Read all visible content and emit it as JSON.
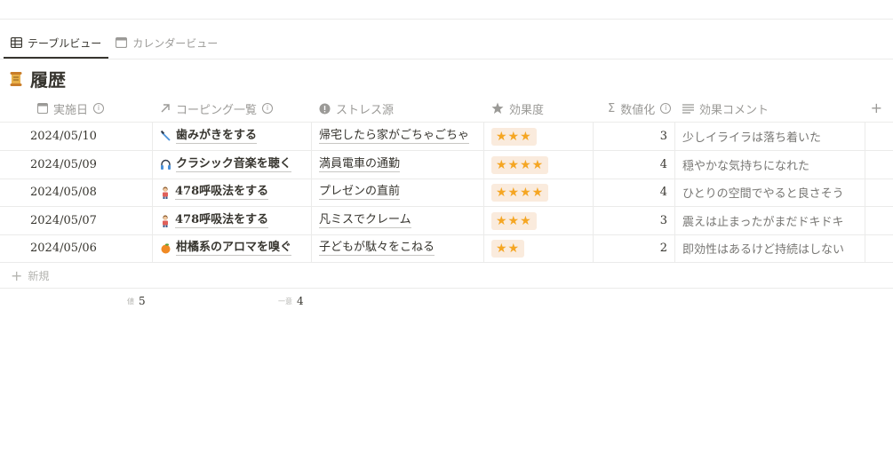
{
  "tabs": [
    {
      "label": "テーブルビュー",
      "icon": "table-icon",
      "active": true
    },
    {
      "label": "カレンダービュー",
      "icon": "calendar-icon",
      "active": false
    }
  ],
  "title": "履歴",
  "columns": {
    "date": "実施日",
    "coping": "コーピング一覧",
    "stress": "ストレス源",
    "effect": "効果度",
    "numeric": "数値化",
    "comment": "効果コメント"
  },
  "rows": [
    {
      "date": "2024/05/10",
      "coping": "歯みがきをする",
      "coping_icon": "toothbrush-icon",
      "stress": "帰宅したら家がごちゃごちゃ",
      "effect": "★★★",
      "numeric": "3",
      "comment": "少しイライラは落ち着いた"
    },
    {
      "date": "2024/05/09",
      "coping": "クラシック音楽を聴く",
      "coping_icon": "headphones-icon",
      "stress": "満員電車の通勤",
      "effect": "★★★★",
      "numeric": "4",
      "comment": "穏やかな気持ちになれた"
    },
    {
      "date": "2024/05/08",
      "coping": "478呼吸法をする",
      "coping_icon": "person-icon",
      "stress": "プレゼンの直前",
      "effect": "★★★★",
      "numeric": "4",
      "comment": "ひとりの空間でやると良さそう"
    },
    {
      "date": "2024/05/07",
      "coping": "478呼吸法をする",
      "coping_icon": "person-icon",
      "stress": "凡ミスでクレーム",
      "effect": "★★★",
      "numeric": "3",
      "comment": "震えは止まったがまだドキドキ"
    },
    {
      "date": "2024/05/06",
      "coping": "柑橘系のアロマを嗅ぐ",
      "coping_icon": "orange-icon",
      "stress": "子どもが駄々をこねる",
      "effect": "★★",
      "numeric": "2",
      "comment": "即効性はあるけど持続はしない"
    }
  ],
  "new_label": "新規",
  "footer": {
    "count_label": "値",
    "count_value": "5",
    "unique_label": "一意",
    "unique_value": "4"
  },
  "colors": {
    "star": "#f5a623",
    "star_bg": "#faebdd",
    "text": "#37352f",
    "muted": "#9b9a97",
    "border": "#ebebea"
  }
}
